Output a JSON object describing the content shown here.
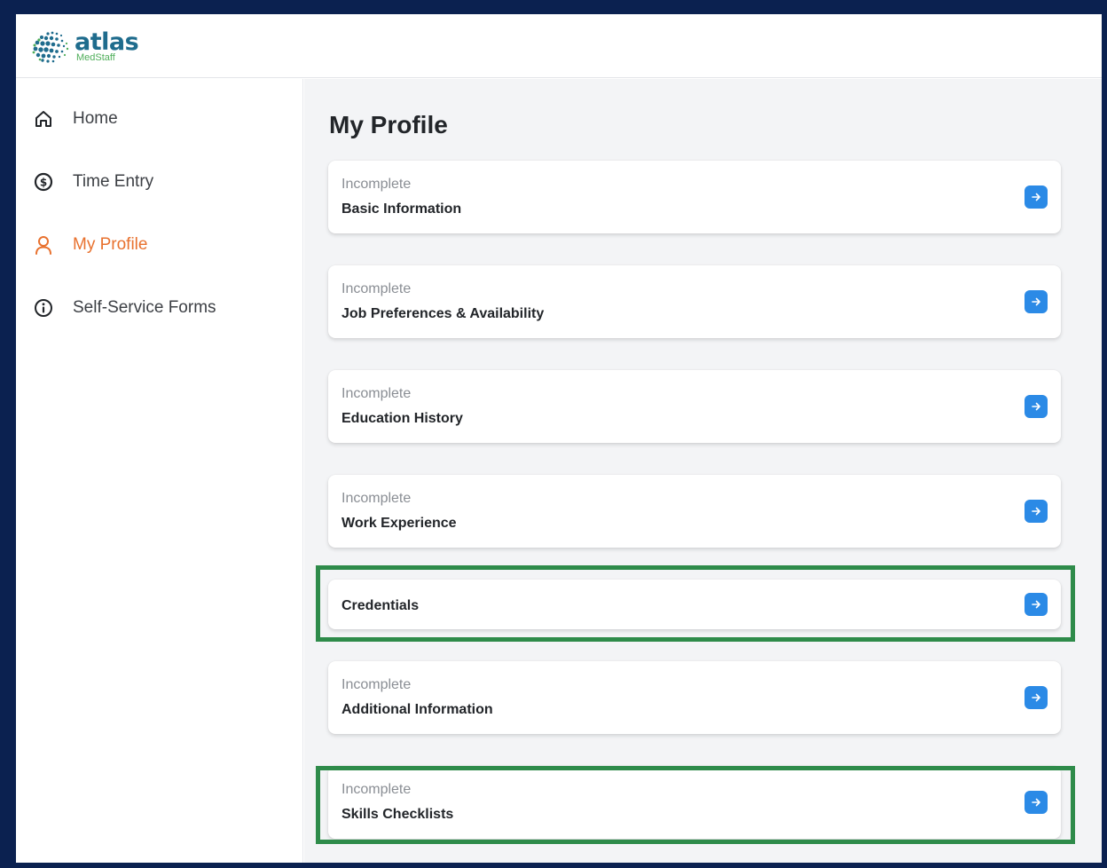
{
  "brand": {
    "name": "atlas",
    "sub": "MedStaff",
    "logo_colors": [
      "#1f6c8d",
      "#4fae5a"
    ]
  },
  "sidebar": {
    "items": [
      {
        "label": "Home",
        "icon": "home-icon",
        "active": false
      },
      {
        "label": "Time Entry",
        "icon": "dollar-circle-icon",
        "active": false
      },
      {
        "label": "My Profile",
        "icon": "user-icon",
        "active": true
      },
      {
        "label": "Self-Service Forms",
        "icon": "info-circle-icon",
        "active": false
      }
    ]
  },
  "main": {
    "title": "My Profile",
    "cards": [
      {
        "status": "Incomplete",
        "title": "Basic Information"
      },
      {
        "status": "Incomplete",
        "title": "Job Preferences & Availability"
      },
      {
        "status": "Incomplete",
        "title": "Education History"
      },
      {
        "status": "Incomplete",
        "title": "Work Experience"
      },
      {
        "status": "",
        "title": "Credentials",
        "highlighted": true
      },
      {
        "status": "Incomplete",
        "title": "Additional Information"
      },
      {
        "status": "Incomplete",
        "title": "Skills Checklists",
        "highlighted": true
      }
    ]
  },
  "colors": {
    "accent_active": "#e8712e",
    "arrow_button": "#2b8ae6",
    "highlight_box": "#2e8b4a",
    "outer_border": "#0b2150"
  }
}
